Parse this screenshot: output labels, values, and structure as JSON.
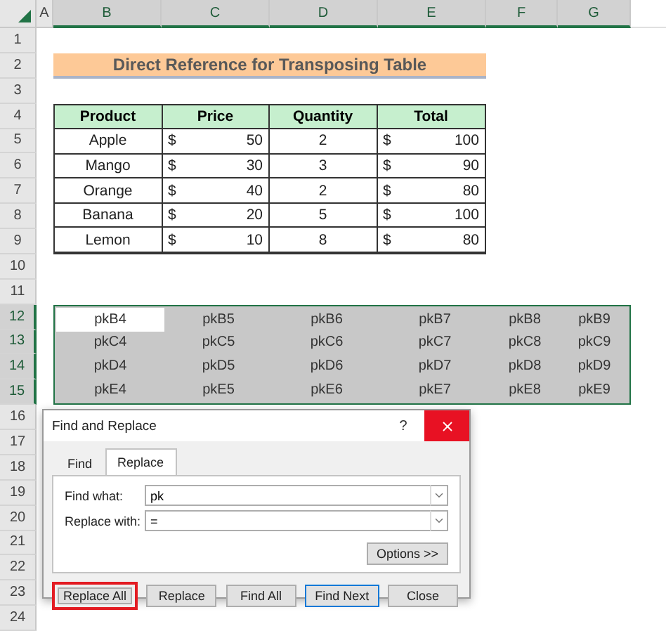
{
  "sheet": {
    "columns": [
      {
        "label": "A",
        "selected": false
      },
      {
        "label": "B",
        "selected": true
      },
      {
        "label": "C",
        "selected": true
      },
      {
        "label": "D",
        "selected": true
      },
      {
        "label": "E",
        "selected": true
      },
      {
        "label": "F",
        "selected": true
      },
      {
        "label": "G",
        "selected": true
      }
    ],
    "rows": [
      {
        "label": "1",
        "selected": false
      },
      {
        "label": "2",
        "selected": false
      },
      {
        "label": "3",
        "selected": false
      },
      {
        "label": "4",
        "selected": false
      },
      {
        "label": "5",
        "selected": false
      },
      {
        "label": "6",
        "selected": false
      },
      {
        "label": "7",
        "selected": false
      },
      {
        "label": "8",
        "selected": false
      },
      {
        "label": "9",
        "selected": false
      },
      {
        "label": "10",
        "selected": false
      },
      {
        "label": "11",
        "selected": false
      },
      {
        "label": "12",
        "selected": true
      },
      {
        "label": "13",
        "selected": true
      },
      {
        "label": "14",
        "selected": true
      },
      {
        "label": "15",
        "selected": true
      },
      {
        "label": "16",
        "selected": false
      },
      {
        "label": "17",
        "selected": false
      },
      {
        "label": "18",
        "selected": false
      },
      {
        "label": "19",
        "selected": false
      },
      {
        "label": "20",
        "selected": false
      },
      {
        "label": "21",
        "selected": false
      },
      {
        "label": "22",
        "selected": false
      },
      {
        "label": "23",
        "selected": false
      },
      {
        "label": "24",
        "selected": false
      }
    ]
  },
  "title": "Direct Reference for Transposing Table",
  "table": {
    "columns": [
      "Product",
      "Price",
      "Quantity",
      "Total"
    ],
    "rows": [
      {
        "product": "Apple",
        "price_symbol": "$",
        "price": "50",
        "quantity": "2",
        "total_symbol": "$",
        "total": "100"
      },
      {
        "product": "Mango",
        "price_symbol": "$",
        "price": "30",
        "quantity": "3",
        "total_symbol": "$",
        "total": "90"
      },
      {
        "product": "Orange",
        "price_symbol": "$",
        "price": "40",
        "quantity": "2",
        "total_symbol": "$",
        "total": "80"
      },
      {
        "product": "Banana",
        "price_symbol": "$",
        "price": "20",
        "quantity": "5",
        "total_symbol": "$",
        "total": "100"
      },
      {
        "product": "Lemon",
        "price_symbol": "$",
        "price": "10",
        "quantity": "8",
        "total_symbol": "$",
        "total": "80"
      }
    ]
  },
  "transposed": [
    [
      {
        "text": "pkB4",
        "active": true
      },
      {
        "text": "pkB5",
        "active": false
      },
      {
        "text": "pkB6",
        "active": false
      },
      {
        "text": "pkB7",
        "active": false
      },
      {
        "text": "pkB8",
        "active": false
      },
      {
        "text": "pkB9",
        "active": false
      }
    ],
    [
      {
        "text": "pkC4",
        "active": false
      },
      {
        "text": "pkC5",
        "active": false
      },
      {
        "text": "pkC6",
        "active": false
      },
      {
        "text": "pkC7",
        "active": false
      },
      {
        "text": "pkC8",
        "active": false
      },
      {
        "text": "pkC9",
        "active": false
      }
    ],
    [
      {
        "text": "pkD4",
        "active": false
      },
      {
        "text": "pkD5",
        "active": false
      },
      {
        "text": "pkD6",
        "active": false
      },
      {
        "text": "pkD7",
        "active": false
      },
      {
        "text": "pkD8",
        "active": false
      },
      {
        "text": "pkD9",
        "active": false
      }
    ],
    [
      {
        "text": "pkE4",
        "active": false
      },
      {
        "text": "pkE5",
        "active": false
      },
      {
        "text": "pkE6",
        "active": false
      },
      {
        "text": "pkE7",
        "active": false
      },
      {
        "text": "pkE8",
        "active": false
      },
      {
        "text": "pkE9",
        "active": false
      }
    ]
  ],
  "dialog": {
    "title": "Find and Replace",
    "help": "?",
    "tabs": [
      {
        "label": "Find",
        "selected": false
      },
      {
        "label": "Replace",
        "selected": true
      }
    ],
    "fields": [
      {
        "label": "Find what:",
        "value": "pk"
      },
      {
        "label": "Replace with:",
        "value": "="
      }
    ],
    "options_button": "Options >>",
    "buttons": [
      {
        "label": "Replace All",
        "highlighted": true,
        "default": false
      },
      {
        "label": "Replace",
        "highlighted": false,
        "default": false
      },
      {
        "label": "Find All",
        "highlighted": false,
        "default": false
      },
      {
        "label": "Find Next",
        "highlighted": false,
        "default": true
      },
      {
        "label": "Close",
        "highlighted": false,
        "default": false
      }
    ]
  }
}
